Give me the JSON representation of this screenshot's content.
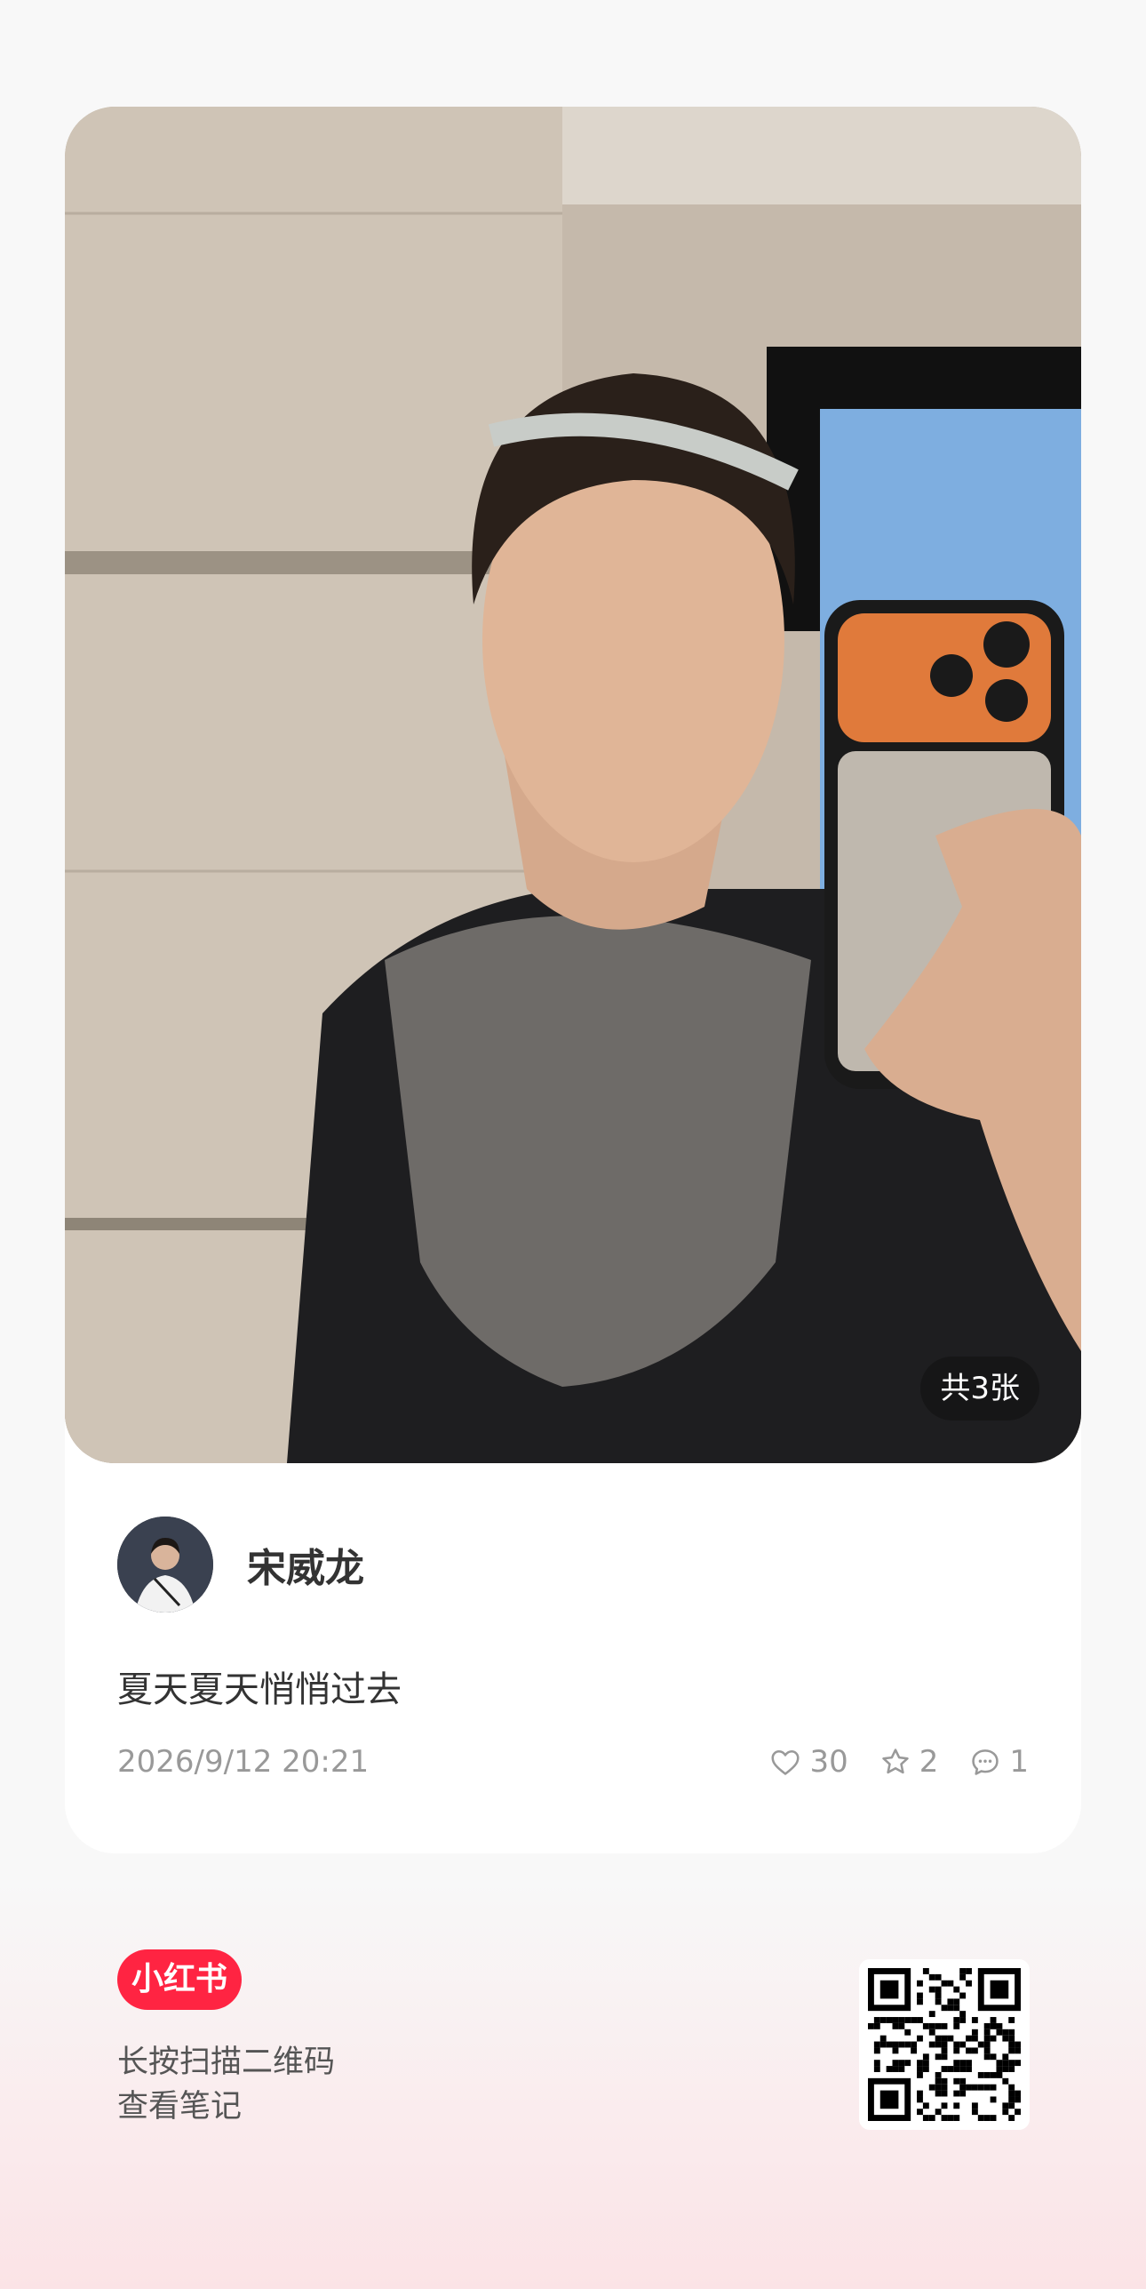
{
  "post": {
    "image_count_label": "共3张",
    "author_name": "宋威龙",
    "text": "夏天夏天悄悄过去",
    "date": "2026/9/12 20:21",
    "stats": {
      "likes": "30",
      "collects": "2",
      "comments": "1"
    }
  },
  "footer": {
    "brand": "小红书",
    "scan_line1": "长按扫描二维码",
    "scan_line2": "查看笔记"
  },
  "colors": {
    "brand": "#ff2442",
    "text": "#333333",
    "muted": "#999999"
  },
  "icons": {
    "like": "heart-icon",
    "collect": "star-icon",
    "comment": "comment-icon"
  }
}
